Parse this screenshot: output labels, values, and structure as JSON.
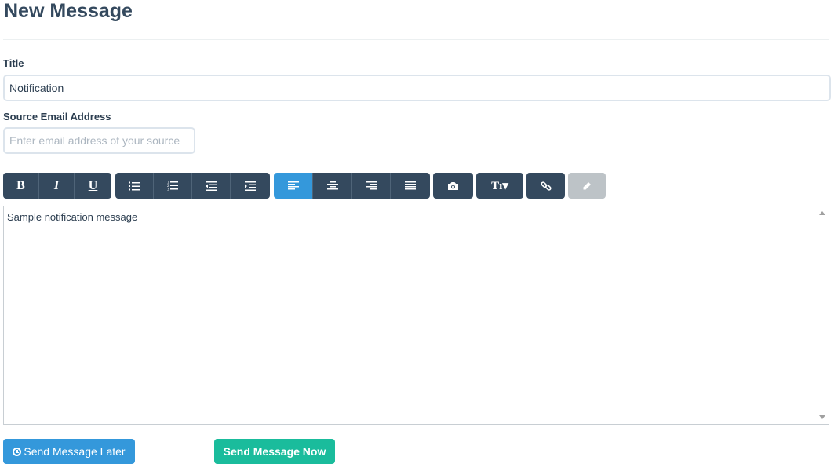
{
  "header": {
    "title": "New Message"
  },
  "form": {
    "title_label": "Title",
    "title_value": "Notification",
    "email_label": "Source Email Address",
    "email_placeholder": "Enter email address of your source"
  },
  "toolbar": {
    "bold": "B",
    "italic": "I",
    "underline": "U",
    "font_size": "Tı▾",
    "icons": [
      "bold-icon",
      "italic-icon",
      "underline-icon",
      "bullet-list-icon",
      "numbered-list-icon",
      "outdent-icon",
      "indent-icon",
      "align-left-icon",
      "align-center-icon",
      "align-right-icon",
      "align-justify-icon",
      "camera-icon",
      "font-size-icon",
      "link-icon",
      "eraser-icon"
    ],
    "active": "align-left",
    "disabled": "eraser",
    "colors": {
      "default": "#34495e",
      "active": "#3498db",
      "disabled": "#bdc3c7"
    }
  },
  "editor": {
    "content": "Sample notification message"
  },
  "actions": {
    "later_label": "Send Message Later",
    "now_label": "Send Message Now",
    "colors": {
      "later": "#3498db",
      "now": "#1abc9c"
    }
  }
}
